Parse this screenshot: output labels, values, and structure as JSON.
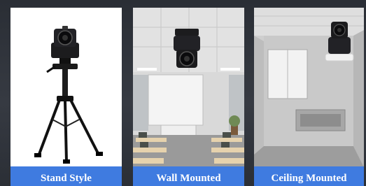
{
  "panels": [
    {
      "caption": "Stand Style",
      "icon": "ptz-camera-on-tripod"
    },
    {
      "caption": "Wall Mounted",
      "icon": "ptz-camera-in-classroom"
    },
    {
      "caption": "Ceiling Mounted",
      "icon": "ptz-camera-ceiling-bracket"
    }
  ],
  "colors": {
    "background": "#2b2f36",
    "caption_bar": "#3f7be0",
    "caption_text": "#ffffff"
  }
}
